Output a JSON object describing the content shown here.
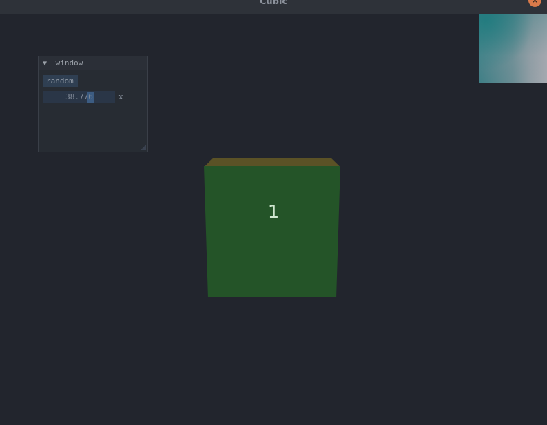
{
  "window": {
    "title": "Cubic",
    "minimize_icon": "minimize-icon",
    "close_icon": "close-icon",
    "minimize_glyph": "–",
    "close_glyph": "×"
  },
  "imgui_panel": {
    "title": "window",
    "collapse_icon": "collapse-triangle-icon",
    "collapse_glyph": "▼",
    "random_button_label": "random",
    "slider_value": "38.776",
    "slider_label": "x"
  },
  "scene": {
    "cube_label": "1",
    "cube_front_color": "#245428",
    "cube_top_color": "#5b5226",
    "background_color": "#22252d"
  }
}
